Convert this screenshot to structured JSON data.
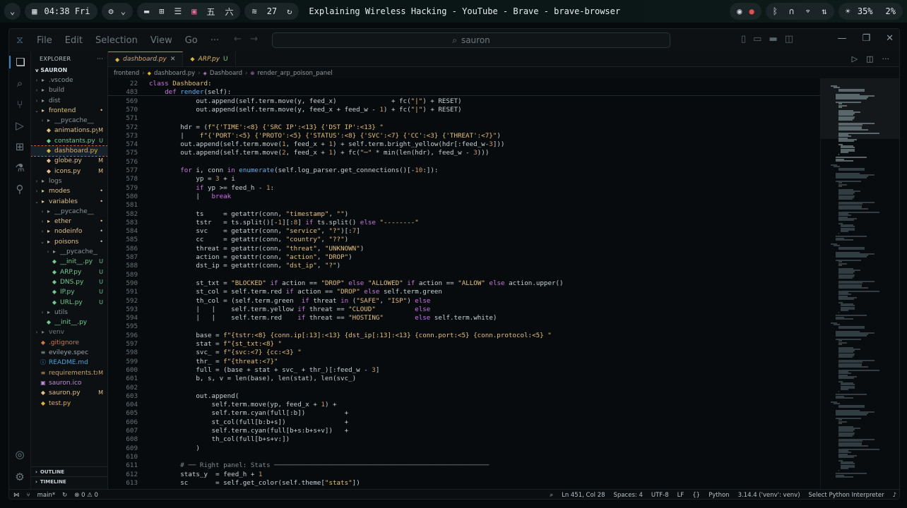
{
  "system_bar": {
    "clock": "04:38 Fri",
    "workspace_count": "27",
    "window_title": "Explaining Wireless Hacking - YouTube - Brave - brave-browser",
    "brightness": "35%",
    "volume": "2%"
  },
  "vscode": {
    "menu": [
      "File",
      "Edit",
      "Selection",
      "View",
      "Go",
      "···"
    ],
    "search_placeholder": "sauron",
    "sidebar": {
      "header": "EXPLORER",
      "root": "SAURON",
      "items": [
        {
          "name": ".vscode",
          "type": "folder",
          "depth": 0,
          "chev": ">",
          "status": ""
        },
        {
          "name": "build",
          "type": "folder",
          "depth": 0,
          "chev": ">",
          "status": ""
        },
        {
          "name": "dist",
          "type": "folder",
          "depth": 0,
          "chev": ">",
          "status": ""
        },
        {
          "name": "frontend",
          "type": "folder-mod",
          "depth": 0,
          "chev": "v",
          "status": "•"
        },
        {
          "name": "__pycache__",
          "type": "folder",
          "depth": 1,
          "chev": ">",
          "status": ""
        },
        {
          "name": "animations.py",
          "type": "py-mod",
          "depth": 1,
          "chev": "",
          "status": "M"
        },
        {
          "name": "constants.py",
          "type": "py-new",
          "depth": 1,
          "chev": "",
          "status": "U"
        },
        {
          "name": "dashboard.py",
          "type": "py-sel",
          "depth": 1,
          "chev": "",
          "status": ""
        },
        {
          "name": "globe.py",
          "type": "py-mod",
          "depth": 1,
          "chev": "",
          "status": "M"
        },
        {
          "name": "icons.py",
          "type": "py-mod",
          "depth": 1,
          "chev": "",
          "status": "M"
        },
        {
          "name": "logs",
          "type": "folder",
          "depth": 0,
          "chev": ">",
          "status": ""
        },
        {
          "name": "modes",
          "type": "folder-mod",
          "depth": 0,
          "chev": ">",
          "status": "•"
        },
        {
          "name": "variables",
          "type": "folder-mod",
          "depth": 0,
          "chev": "v",
          "status": "•"
        },
        {
          "name": "__pycache__",
          "type": "folder",
          "depth": 1,
          "chev": ">",
          "status": ""
        },
        {
          "name": "ether",
          "type": "folder-mod",
          "depth": 1,
          "chev": ">",
          "status": "•"
        },
        {
          "name": "nodeinfo",
          "type": "folder-mod",
          "depth": 1,
          "chev": ">",
          "status": "•"
        },
        {
          "name": "poisons",
          "type": "folder-mod",
          "depth": 1,
          "chev": "v",
          "status": "•"
        },
        {
          "name": "__pycache__",
          "type": "folder",
          "depth": 2,
          "chev": ">",
          "status": ""
        },
        {
          "name": "__init__.py",
          "type": "py-new",
          "depth": 2,
          "chev": "",
          "status": "U"
        },
        {
          "name": "ARP.py",
          "type": "py-new",
          "depth": 2,
          "chev": "",
          "status": "U"
        },
        {
          "name": "DNS.py",
          "type": "py-new",
          "depth": 2,
          "chev": "",
          "status": "U"
        },
        {
          "name": "IP.py",
          "type": "py-new",
          "depth": 2,
          "chev": "",
          "status": "U"
        },
        {
          "name": "URL.py",
          "type": "py-new",
          "depth": 2,
          "chev": "",
          "status": "U"
        },
        {
          "name": "utils",
          "type": "folder",
          "depth": 1,
          "chev": ">",
          "status": ""
        },
        {
          "name": "__init__.py",
          "type": "py-new",
          "depth": 1,
          "chev": "",
          "status": ""
        },
        {
          "name": "venv",
          "type": "venv",
          "depth": 0,
          "chev": ">",
          "status": ""
        },
        {
          "name": ".gitignore",
          "type": "git",
          "depth": 0,
          "chev": "",
          "status": ""
        },
        {
          "name": "evileye.spec",
          "type": "spec",
          "depth": 0,
          "chev": "",
          "status": ""
        },
        {
          "name": "README.md",
          "type": "md",
          "depth": 0,
          "chev": "",
          "status": ""
        },
        {
          "name": "requirements.txt",
          "type": "txt",
          "depth": 0,
          "chev": "",
          "status": "M"
        },
        {
          "name": "sauron.ico",
          "type": "ico",
          "depth": 0,
          "chev": "",
          "status": ""
        },
        {
          "name": "sauron.py",
          "type": "py-mod",
          "depth": 0,
          "chev": "",
          "status": "M"
        },
        {
          "name": "test.py",
          "type": "py",
          "depth": 0,
          "chev": "",
          "status": ""
        }
      ],
      "outline": "OUTLINE",
      "timeline": "TIMELINE"
    },
    "tabs": [
      {
        "label": "dashboard.py",
        "active": true,
        "badge": ""
      },
      {
        "label": "ARP.py",
        "active": false,
        "badge": "U"
      }
    ],
    "breadcrumb": [
      "frontend",
      "dashboard.py",
      "Dashboard",
      "render_arp_poison_panel"
    ],
    "status_bar": {
      "branch": "main*",
      "errors": "0",
      "warnings": "0",
      "position": "Ln 451, Col 28",
      "spaces": "Spaces: 4",
      "encoding": "UTF-8",
      "eol": "LF",
      "language": "Python",
      "interpreter": "3.14.4 ('venv': venv)",
      "select_interpreter": "Select Python Interpreter"
    },
    "code_lines": [
      {
        "n": "22",
        "html": "<span class='k'>class</span> <span class='cls'>Dashboard</span>:"
      },
      {
        "n": "483",
        "html": "    <span class='k'>def</span> <span class='fn'>render</span>(self):"
      },
      {
        "n": "569",
        "html": "            out.append(self.term.move(y, feed_x)              + fc(<span class='s'>\"|\"</span>) + RESET)"
      },
      {
        "n": "570",
        "html": "            out.append(self.term.move(y, feed_x + feed_w - <span class='nm2'>1</span>) + fc(<span class='s'>\"|\"</span>) + RESET)"
      },
      {
        "n": "571",
        "html": ""
      },
      {
        "n": "572",
        "html": "        hdr = (<span class='s'>f\"{'TIME':&lt;8} {'SRC IP':&lt;13} {'DST IP':&lt;13} \"</span>"
      },
      {
        "n": "573",
        "html": "        |    <span class='s'>f\"{'PORT':&lt;5} {'PROTO':&lt;5} {'STATUS':&lt;8} {'SVC':&lt;7} {'CC':&lt;3} {'THREAT':&lt;7}\"</span>)"
      },
      {
        "n": "574",
        "html": "        out.append(self.term.move(<span class='nm2'>1</span>, feed_x + <span class='nm2'>1</span>) + self.term.bright_yellow(hdr[:feed_w-<span class='nm2'>3</span>]))"
      },
      {
        "n": "575",
        "html": "        out.append(self.term.move(<span class='nm2'>2</span>, feed_x + <span class='nm2'>1</span>) + fc(<span class='s'>\"─\"</span> * min(len(hdr), feed_w - <span class='nm2'>3</span>)))"
      },
      {
        "n": "576",
        "html": ""
      },
      {
        "n": "577",
        "html": "        <span class='k'>for</span> i, conn <span class='k'>in</span> <span class='fn'>enumerate</span>(self.log_parser.get_connections()[-<span class='nm2'>10</span>:]):"
      },
      {
        "n": "578",
        "html": "            yp = <span class='nm2'>3</span> + i"
      },
      {
        "n": "579",
        "html": "            <span class='k'>if</span> yp &gt;= feed_h - <span class='nm2'>1</span>:"
      },
      {
        "n": "580",
        "html": "            |   <span class='k'>break</span>"
      },
      {
        "n": "581",
        "html": ""
      },
      {
        "n": "582",
        "html": "            ts     = getattr(conn, <span class='s'>\"timestamp\"</span>, <span class='s'>\"\"</span>)"
      },
      {
        "n": "583",
        "html": "            tstr   = ts.split()[-<span class='nm2'>1</span>][:<span class='nm2'>8</span>] <span class='k'>if</span> ts.split() <span class='k'>else</span> <span class='s'>\"--------\"</span>"
      },
      {
        "n": "584",
        "html": "            svc    = getattr(conn, <span class='s'>\"service\"</span>, <span class='s'>\"?\"</span>)[:<span class='nm2'>7</span>]"
      },
      {
        "n": "585",
        "html": "            cc     = getattr(conn, <span class='s'>\"country\"</span>, <span class='s'>\"??\"</span>)"
      },
      {
        "n": "586",
        "html": "            threat = getattr(conn, <span class='s'>\"threat\"</span>, <span class='s'>\"UNKNOWN\"</span>)"
      },
      {
        "n": "587",
        "html": "            action = getattr(conn, <span class='s'>\"action\"</span>, <span class='s'>\"DROP\"</span>)"
      },
      {
        "n": "588",
        "html": "            dst_ip = getattr(conn, <span class='s'>\"dst_ip\"</span>, <span class='s'>\"?\"</span>)"
      },
      {
        "n": "589",
        "html": ""
      },
      {
        "n": "590",
        "html": "            st_txt = <span class='s'>\"BLOCKED\"</span> <span class='k'>if</span> action == <span class='s'>\"DROP\"</span> <span class='k'>else</span> <span class='s'>\"ALLOWED\"</span> <span class='k'>if</span> action == <span class='s'>\"ALLOW\"</span> <span class='k'>else</span> action.upper()"
      },
      {
        "n": "591",
        "html": "            st_col = self.term.red <span class='k'>if</span> action == <span class='s'>\"DROP\"</span> <span class='k'>else</span> self.term.green"
      },
      {
        "n": "592",
        "html": "            th_col = (self.term.green  <span class='k'>if</span> threat <span class='k'>in</span> (<span class='s'>\"SAFE\"</span>, <span class='s'>\"ISP\"</span>) <span class='k'>else</span>"
      },
      {
        "n": "593",
        "html": "            |   |    self.term.yellow <span class='k'>if</span> threat == <span class='s'>\"CLOUD\"</span>          <span class='k'>else</span>"
      },
      {
        "n": "594",
        "html": "            |   |    self.term.red    <span class='k'>if</span> threat == <span class='s'>\"HOSTING\"</span>        <span class='k'>else</span> self.term.white)"
      },
      {
        "n": "595",
        "html": ""
      },
      {
        "n": "596",
        "html": "            base = <span class='s'>f\"{tstr:&lt;8} {conn.ip[:13]:&lt;13} {dst_ip[:13]:&lt;13} {conn.port:&lt;5} {conn.protocol:&lt;5} \"</span>"
      },
      {
        "n": "597",
        "html": "            stat = <span class='s'>f\"{st_txt:&lt;8} \"</span>"
      },
      {
        "n": "598",
        "html": "            svc_ = <span class='s'>f\"{svc:&lt;7} {cc:&lt;3} \"</span>"
      },
      {
        "n": "599",
        "html": "            thr_ = <span class='s'>f\"{threat:&lt;7}\"</span>"
      },
      {
        "n": "600",
        "html": "            full = (base + stat + svc_ + thr_)[:feed_w - <span class='nm2'>3</span>]"
      },
      {
        "n": "601",
        "html": "            b, s, v = len(base), len(stat), len(svc_)"
      },
      {
        "n": "602",
        "html": ""
      },
      {
        "n": "603",
        "html": "            out.append("
      },
      {
        "n": "604",
        "html": "                self.term.move(yp, feed_x + <span class='nm2'>1</span>) +"
      },
      {
        "n": "605",
        "html": "                self.term.cyan(full[:b])          +"
      },
      {
        "n": "606",
        "html": "                st_col(full[b:b+s])               +"
      },
      {
        "n": "607",
        "html": "                self.term.cyan(full[b+s:b+s+v])   +"
      },
      {
        "n": "608",
        "html": "                th_col(full[b+s+v:])"
      },
      {
        "n": "609",
        "html": "            )"
      },
      {
        "n": "610",
        "html": ""
      },
      {
        "n": "611",
        "html": "        <span class='cm'># ── Right panel: Stats ───────────────────────────────────────────────────────</span>"
      },
      {
        "n": "612",
        "html": "        stats_y  = feed_h + <span class='nm2'>1</span>"
      },
      {
        "n": "613",
        "html": "        sc       = self.get_color(self.theme[<span class='s'>\"stats\"</span>])"
      }
    ]
  }
}
